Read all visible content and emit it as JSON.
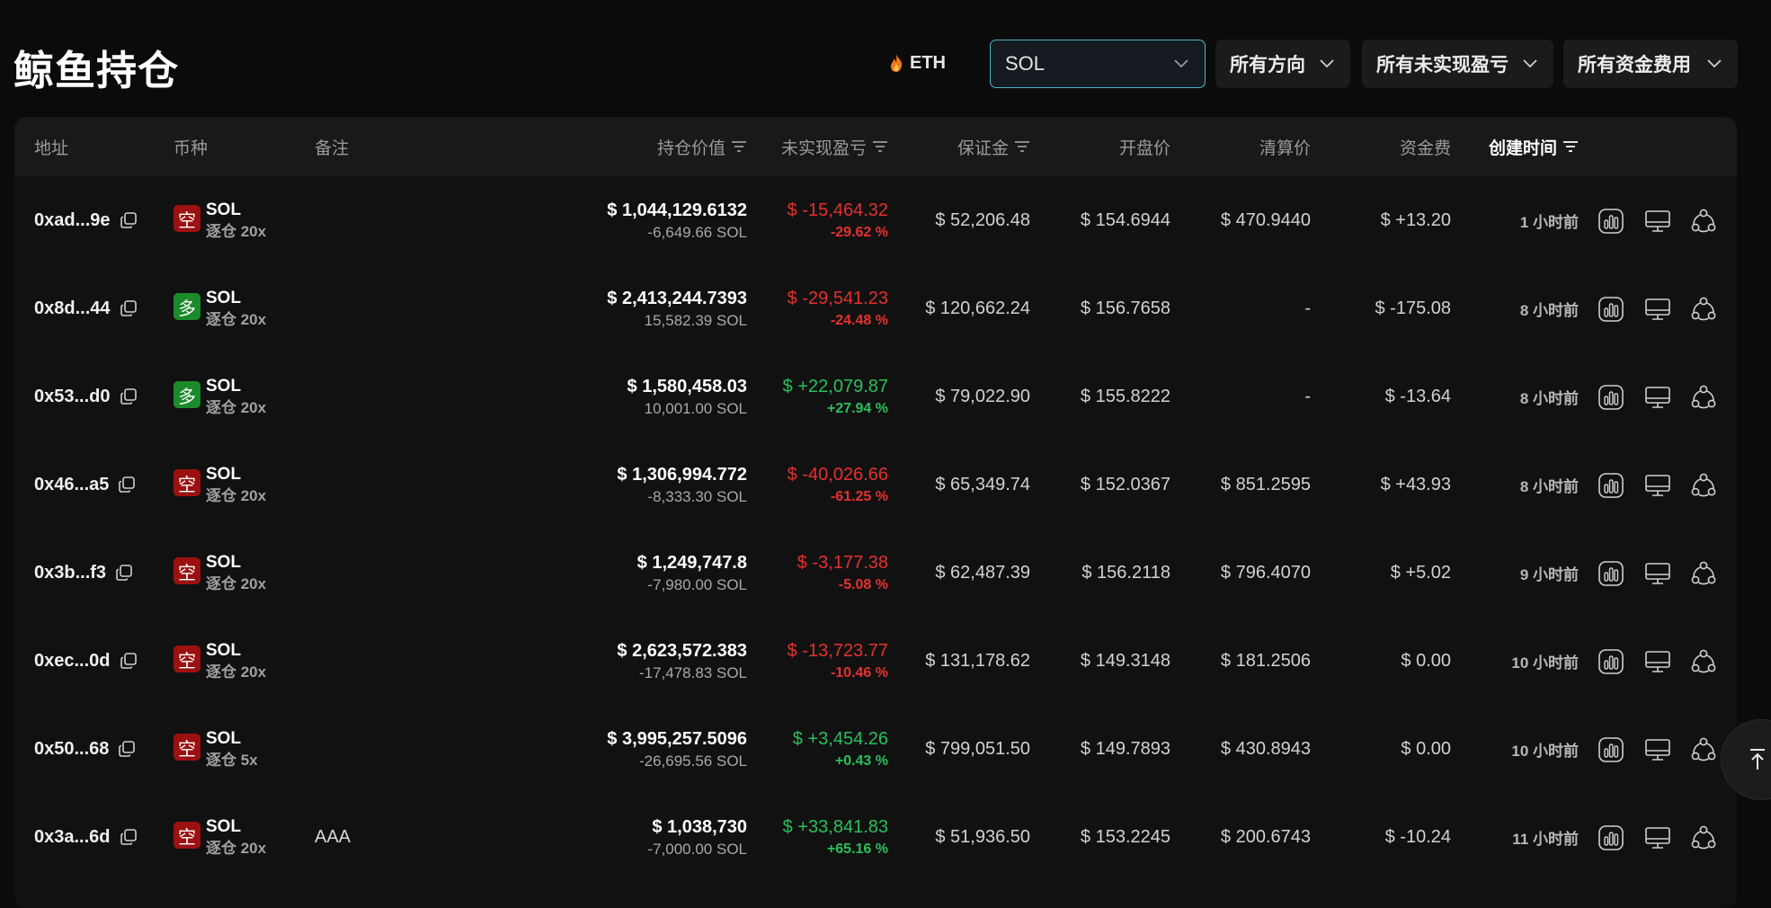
{
  "page": {
    "title": "鲸鱼持仓"
  },
  "filters": {
    "eth_label": "ETH",
    "search_value": "SOL",
    "direction_label": "所有方向",
    "pnl_label": "所有未实现盈亏",
    "funding_label": "所有资金费用"
  },
  "table": {
    "headers": {
      "address": "地址",
      "coin": "币种",
      "note": "备注",
      "position_value": "持仓价值",
      "unrealized_pnl": "未实现盈亏",
      "margin": "保证金",
      "entry_price": "开盘价",
      "liq_price": "清算价",
      "funding": "资金费",
      "created": "创建时间"
    },
    "rows": [
      {
        "address": "0xad...9e",
        "dir": "空",
        "dir_type": "short",
        "coin": "SOL",
        "leverage": "逐仓 20x",
        "note": "",
        "value": "$ 1,044,129.6132",
        "size": "-6,649.66 SOL",
        "pnl": "$ -15,464.32",
        "pnl_pct": "-29.62 %",
        "pnl_sign": "neg",
        "margin": "$ 52,206.48",
        "entry": "$ 154.6944",
        "liq": "$ 470.9440",
        "funding": "$ +13.20",
        "funding_sign": "pos",
        "time": "1 小时前"
      },
      {
        "address": "0x8d...44",
        "dir": "多",
        "dir_type": "long",
        "coin": "SOL",
        "leverage": "逐仓 20x",
        "note": "",
        "value": "$ 2,413,244.7393",
        "size": "15,582.39 SOL",
        "pnl": "$ -29,541.23",
        "pnl_pct": "-24.48 %",
        "pnl_sign": "neg",
        "margin": "$ 120,662.24",
        "entry": "$ 156.7658",
        "liq": "-",
        "funding": "$ -175.08",
        "funding_sign": "neg",
        "time": "8 小时前"
      },
      {
        "address": "0x53...d0",
        "dir": "多",
        "dir_type": "long",
        "coin": "SOL",
        "leverage": "逐仓 20x",
        "note": "",
        "value": "$ 1,580,458.03",
        "size": "10,001.00 SOL",
        "pnl": "$ +22,079.87",
        "pnl_pct": "+27.94 %",
        "pnl_sign": "pos",
        "margin": "$ 79,022.90",
        "entry": "$ 155.8222",
        "liq": "-",
        "funding": "$ -13.64",
        "funding_sign": "neg",
        "time": "8 小时前"
      },
      {
        "address": "0x46...a5",
        "dir": "空",
        "dir_type": "short",
        "coin": "SOL",
        "leverage": "逐仓 20x",
        "note": "",
        "value": "$ 1,306,994.772",
        "size": "-8,333.30 SOL",
        "pnl": "$ -40,026.66",
        "pnl_pct": "-61.25 %",
        "pnl_sign": "neg",
        "margin": "$ 65,349.74",
        "entry": "$ 152.0367",
        "liq": "$ 851.2595",
        "funding": "$ +43.93",
        "funding_sign": "pos",
        "time": "8 小时前"
      },
      {
        "address": "0x3b...f3",
        "dir": "空",
        "dir_type": "short",
        "coin": "SOL",
        "leverage": "逐仓 20x",
        "note": "",
        "value": "$ 1,249,747.8",
        "size": "-7,980.00 SOL",
        "pnl": "$ -3,177.38",
        "pnl_pct": "-5.08 %",
        "pnl_sign": "neg",
        "margin": "$ 62,487.39",
        "entry": "$ 156.2118",
        "liq": "$ 796.4070",
        "funding": "$ +5.02",
        "funding_sign": "pos",
        "time": "9 小时前"
      },
      {
        "address": "0xec...0d",
        "dir": "空",
        "dir_type": "short",
        "coin": "SOL",
        "leverage": "逐仓 20x",
        "note": "",
        "value": "$ 2,623,572.383",
        "size": "-17,478.83 SOL",
        "pnl": "$ -13,723.77",
        "pnl_pct": "-10.46 %",
        "pnl_sign": "neg",
        "margin": "$ 131,178.62",
        "entry": "$ 149.3148",
        "liq": "$ 181.2506",
        "funding": "$ 0.00",
        "funding_sign": "plain",
        "time": "10 小时前"
      },
      {
        "address": "0x50...68",
        "dir": "空",
        "dir_type": "short",
        "coin": "SOL",
        "leverage": "逐仓 5x",
        "note": "",
        "value": "$ 3,995,257.5096",
        "size": "-26,695.56 SOL",
        "pnl": "$ +3,454.26",
        "pnl_pct": "+0.43 %",
        "pnl_sign": "pos",
        "margin": "$ 799,051.50",
        "entry": "$ 149.7893",
        "liq": "$ 430.8943",
        "funding": "$ 0.00",
        "funding_sign": "plain",
        "time": "10 小时前"
      },
      {
        "address": "0x3a...6d",
        "dir": "空",
        "dir_type": "short",
        "coin": "SOL",
        "leverage": "逐仓 20x",
        "note": "AAA",
        "value": "$ 1,038,730",
        "size": "-7,000.00 SOL",
        "pnl": "$ +33,841.83",
        "pnl_pct": "+65.16 %",
        "pnl_sign": "pos",
        "margin": "$ 51,936.50",
        "entry": "$ 153.2245",
        "liq": "$ 200.6743",
        "funding": "$ -10.24",
        "funding_sign": "neg",
        "time": "11 小时前"
      }
    ]
  },
  "icons": {
    "copy": "copy-icon",
    "chart": "chart-icon",
    "monitor": "monitor-icon",
    "share": "share-icon",
    "scroll_top": "arrow-up-to-top-icon",
    "fire": "fire-icon",
    "filter": "filter-icon"
  },
  "colors": {
    "negative": "#e5312f",
    "positive": "#29c05a",
    "short_badge": "#9b1111",
    "long_badge": "#1b8a2b",
    "search_border": "#4fb3c9"
  }
}
